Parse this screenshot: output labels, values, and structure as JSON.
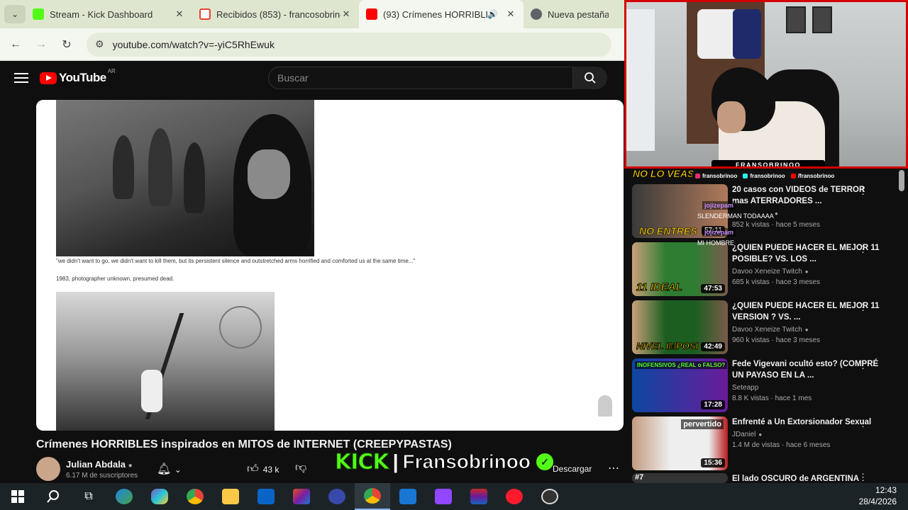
{
  "browser": {
    "tabs": [
      {
        "title": "Stream - Kick Dashboard",
        "favicon_color": "#53fc18",
        "active": false
      },
      {
        "title": "Recibidos (853) - francosobrino",
        "favicon_color": "#ea4335",
        "active": false
      },
      {
        "title": "(93) Crímenes HORRIBLES in",
        "favicon_color": "#ff0000",
        "active": true
      },
      {
        "title": "Nueva pestaña",
        "favicon_color": "#5f6368",
        "active": false
      }
    ],
    "url": "youtube.com/watch?v=-yiC5RhEwuk"
  },
  "youtube": {
    "logo": "YouTube",
    "country_code": "AR",
    "search_placeholder": "Buscar"
  },
  "video": {
    "caption_quote": "\"we didn't want to go, we didn't want to kill them, but its persistent silence and outstretched arms horrified and comforted us at the same time...\"",
    "caption_credit": "1983, photographer unknown, presumed dead.",
    "title": "Crímenes HORRIBLES inspirados en MITOS de INTERNET (CREEPYPASTAS)",
    "channel": "Julian Abdala",
    "subscribers": "6.17 M de suscriptores",
    "likes": "43 k",
    "download_label": "Descargar"
  },
  "overlay": {
    "kick_logo": "KICK",
    "separator": "|",
    "username": "Fransobrinoo",
    "webcam_name": "FRANSOBRINOO",
    "socials": [
      "fransobrinoo",
      "fransobrinoo",
      "/fransobrinoo"
    ],
    "promo1": "NO LO VEAS",
    "promo2": "NO ENTRES",
    "chat": [
      {
        "user": "jojizepam",
        "msg": "SLENDERMAN TODAAAA"
      },
      {
        "user": "jojizepam",
        "msg": "MI HOMBRE"
      }
    ]
  },
  "sidebar": {
    "items": [
      {
        "title": "20 casos con VIDEOS de TERROR mas ATERRADORES ...",
        "channel": "",
        "meta": "852 k vistas · hace 5 meses",
        "duration": "57:11",
        "overtext": "",
        "verified": true,
        "colors": [
          "#3a3a3a",
          "#b07a5a"
        ]
      },
      {
        "title": "¿QUIEN PUEDE HACER EL MEJOR 11 POSIBLE? VS. LOS ...",
        "channel": "Davoo Xeneize Twitch",
        "meta": "685 k vistas · hace 3 meses",
        "duration": "47:53",
        "overtext": "11 IDEAL",
        "verified": true,
        "colors": [
          "#2e7d32",
          "#c9a07a"
        ]
      },
      {
        "title": "¿QUIEN PUEDE HACER EL MEJOR 11 VERSION ? VS. ...",
        "channel": "Davoo Xeneize Twitch",
        "meta": "960 k vistas · hace 3 meses",
        "duration": "42:49",
        "overtext": "NIVEL IMPOSI",
        "verified": true,
        "colors": [
          "#1b5e20",
          "#c9a07a"
        ]
      },
      {
        "title": "Fede Vigevani ocultó esto? (COMPRÉ UN PAYASO EN LA ...",
        "channel": "Seteapp",
        "meta": "8.8 K vistas · hace 1 mes",
        "duration": "17:28",
        "overtext": "",
        "toptext": "INOFENSIVOS ¿REAL o FALSO?",
        "verified": false,
        "colors": [
          "#0d47a1",
          "#6a1b9a"
        ]
      },
      {
        "title": "Enfrenté a Un Extorsionador Sexual",
        "channel": "JDaniel",
        "meta": "1.4 M de vistas · hace 6 meses",
        "duration": "15:36",
        "overtext": "",
        "toptext": "pervertido",
        "verified": true,
        "colors": [
          "#eeeeee",
          "#b71c1c"
        ]
      },
      {
        "title": "El lado OSCURO de ARGENTINA",
        "channel": "",
        "meta": "",
        "duration": "",
        "overtext": "#7",
        "verified": false,
        "colors": [
          "#333333",
          "#555555"
        ]
      }
    ]
  },
  "taskbar": {
    "apps": [
      "windows",
      "search",
      "task-view",
      "edge",
      "copilot",
      "chrome",
      "file-explorer",
      "outlook",
      "office",
      "ai-assistant",
      "chrome-active",
      "store",
      "twitch",
      "winrar",
      "opera",
      "obs"
    ],
    "time": "12:43",
    "date": "28/4/2026"
  },
  "colors": {
    "kick_green": "#53fc18",
    "youtube_red": "#ff0000",
    "webcam_border": "#d30000"
  }
}
